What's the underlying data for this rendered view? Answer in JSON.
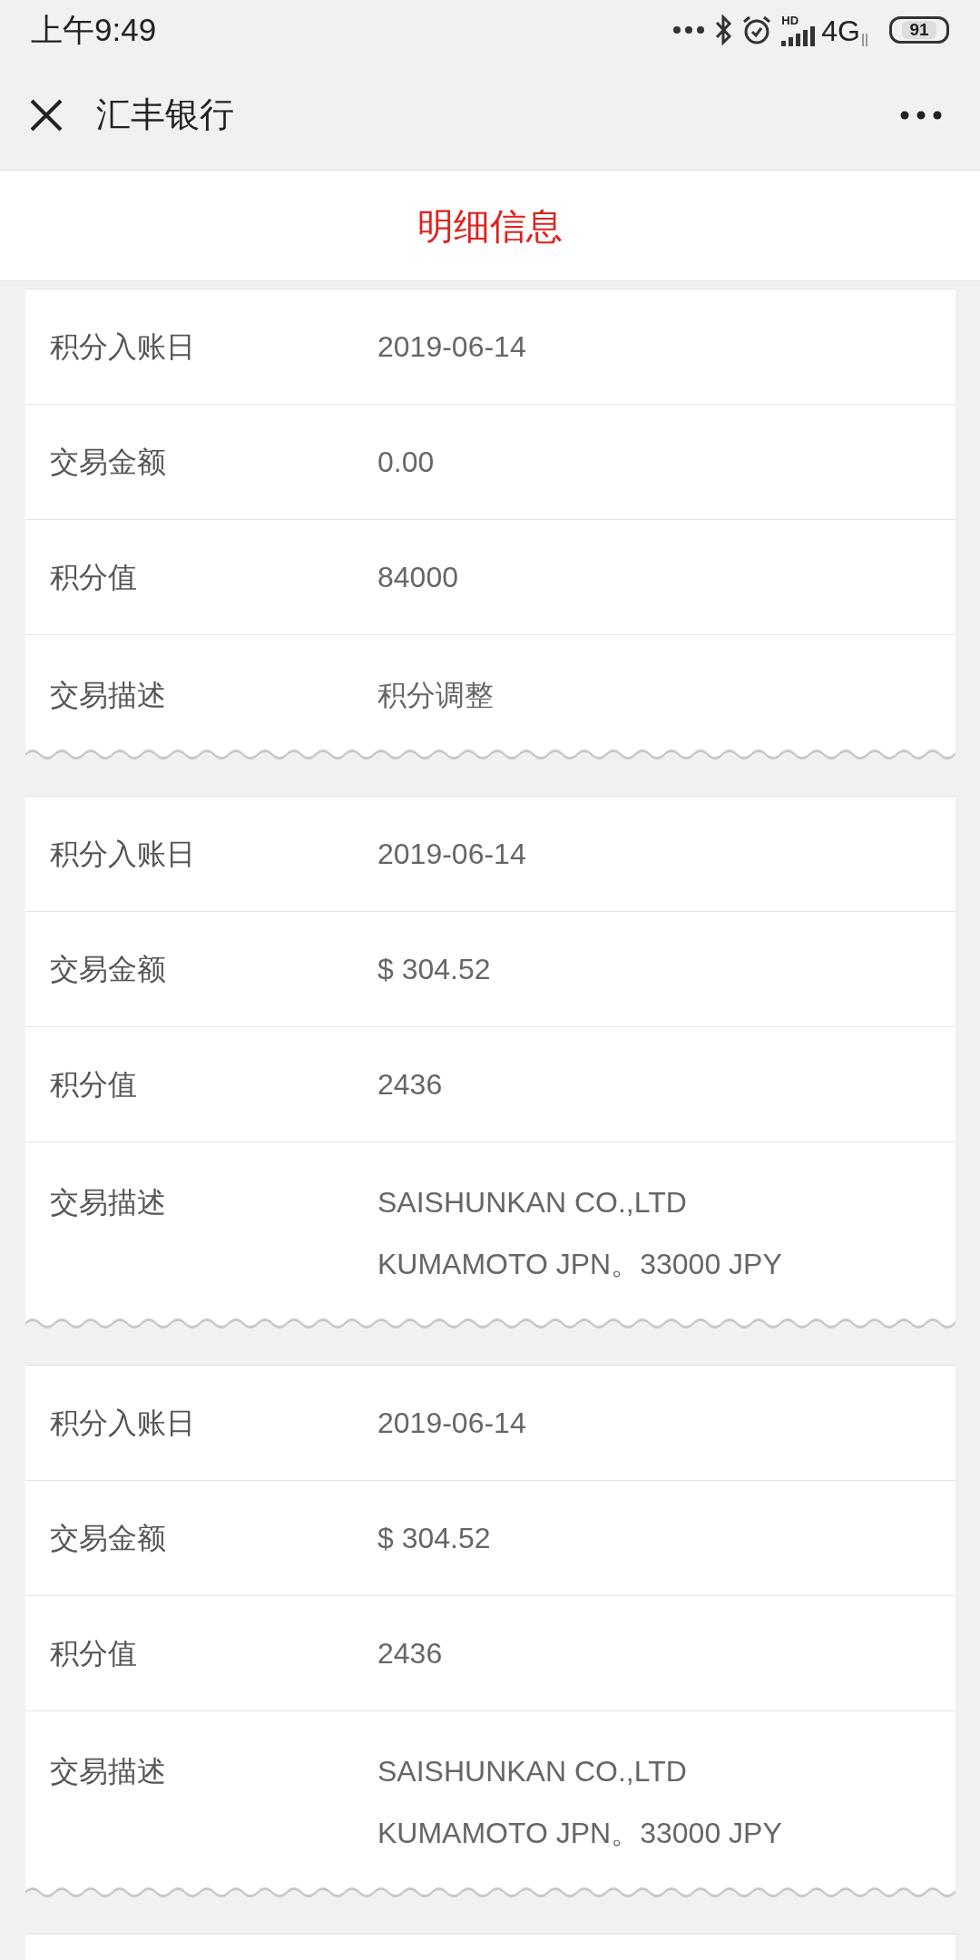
{
  "status_bar": {
    "time": "上午9:49",
    "network_badge": "HD",
    "network": "4G",
    "battery": "91"
  },
  "nav_bar": {
    "title": "汇丰银行"
  },
  "header": {
    "title": "明细信息"
  },
  "cards": [
    {
      "rows": [
        {
          "label": "积分入账日",
          "lines": [
            "2019-06-14"
          ]
        },
        {
          "label": "交易金额",
          "lines": [
            "0.00"
          ]
        },
        {
          "label": "积分值",
          "lines": [
            "84000"
          ]
        },
        {
          "label": "交易描述",
          "lines": [
            "积分调整"
          ]
        }
      ]
    },
    {
      "rows": [
        {
          "label": "积分入账日",
          "lines": [
            "2019-06-14"
          ]
        },
        {
          "label": "交易金额",
          "lines": [
            "$ 304.52"
          ]
        },
        {
          "label": "积分值",
          "lines": [
            "2436"
          ]
        },
        {
          "label": "交易描述",
          "lines": [
            "SAISHUNKAN CO.,LTD",
            "KUMAMOTO JPN。33000 JPY"
          ]
        }
      ]
    },
    {
      "rows": [
        {
          "label": "积分入账日",
          "lines": [
            "2019-06-14"
          ]
        },
        {
          "label": "交易金额",
          "lines": [
            "$ 304.52"
          ]
        },
        {
          "label": "积分值",
          "lines": [
            "2436"
          ]
        },
        {
          "label": "交易描述",
          "lines": [
            "SAISHUNKAN CO.,LTD",
            "KUMAMOTO JPN。33000 JPY"
          ]
        }
      ]
    }
  ]
}
